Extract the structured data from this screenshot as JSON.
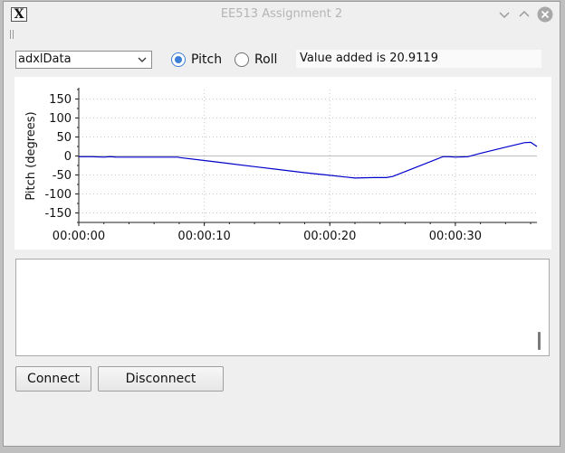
{
  "window": {
    "title": "EE513 Assignment 2",
    "app_icon_glyph": "X",
    "controls": [
      "minimize-icon",
      "maximize-icon",
      "close-icon"
    ]
  },
  "toolbar": {
    "source_select": {
      "selected": "adxlData",
      "icon": "chevron-down-icon"
    },
    "radios": [
      {
        "label": "Pitch",
        "checked": true
      },
      {
        "label": "Roll",
        "checked": false
      }
    ],
    "value_text": "Value added is 20.9119"
  },
  "chart_data": {
    "type": "line",
    "ylabel": "Pitch (degrees)",
    "xlabel": "",
    "ylim": [
      -175,
      175
    ],
    "yticks": [
      150,
      100,
      50,
      0,
      -50,
      -100,
      -150
    ],
    "xlim": [
      0,
      36.5
    ],
    "xticks": [
      {
        "t": 0,
        "label": "00:00:00"
      },
      {
        "t": 10,
        "label": "00:00:10"
      },
      {
        "t": 20,
        "label": "00:00:20"
      },
      {
        "t": 30,
        "label": "00:00:30"
      }
    ],
    "grid": true,
    "series": [
      {
        "color": "#0000cc",
        "x": [
          0,
          1,
          2,
          2.5,
          3,
          4,
          5,
          6,
          7,
          7.9,
          8,
          10,
          12,
          14,
          16,
          18,
          20,
          22,
          23.5,
          24.5,
          25,
          27,
          29,
          29.5,
          30,
          31,
          32,
          34,
          35.5,
          36,
          36.5
        ],
        "y": [
          -2,
          -2,
          -3,
          -2,
          -3,
          -3,
          -3,
          -3,
          -3,
          -3,
          -4,
          -12,
          -20,
          -28,
          -36,
          -44,
          -51,
          -58,
          -57,
          -57,
          -54,
          -28,
          -2,
          -2,
          -3,
          -2,
          7,
          23,
          35,
          36,
          25
        ]
      }
    ]
  },
  "log": {
    "text": ""
  },
  "buttons": {
    "connect_label": "Connect",
    "disconnect_label": "Disconnect"
  }
}
